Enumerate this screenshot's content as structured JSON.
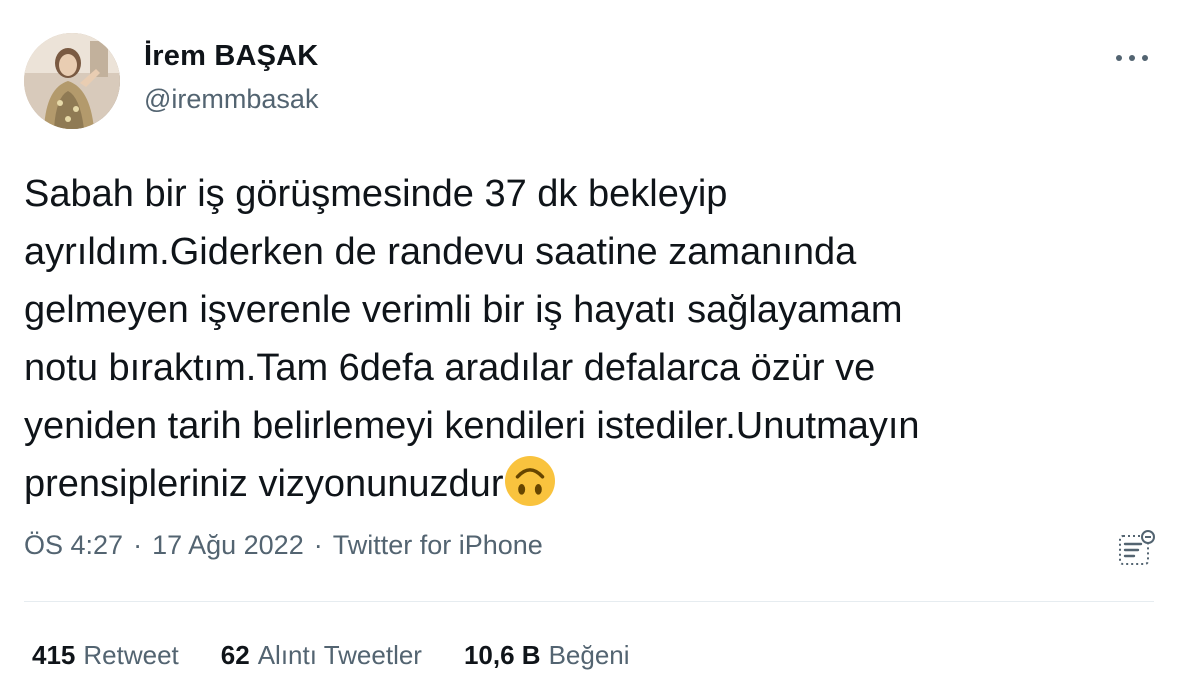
{
  "author": {
    "display_name": "İrem BAŞAK",
    "handle": "@iremmbasak",
    "avatar_icon": "profile-photo"
  },
  "more_icon": "more-horizontal-icon",
  "tweet": {
    "text_lines": [
      "Sabah bir iş görüşmesinde 37 dk bekleyip",
      "ayrıldım.Giderken de randevu saatine zamanında",
      "gelmeyen işverenle verimli bir iş hayatı sağlayamam",
      "notu bıraktım.Tam 6defa aradılar defalarca özür ve",
      "yeniden tarih belirlemeyi kendileri istediler.Unutmayın",
      "prensipleriniz vizyonunuzdur"
    ],
    "emoji": "upside-down-face-emoji"
  },
  "meta": {
    "time": "ÖS 4:27",
    "separator": "·",
    "date": "17 Ağu 2022",
    "source": "Twitter for iPhone"
  },
  "analytics_icon": "analytics-icon",
  "stats": {
    "retweets": {
      "count": "415",
      "label": "Retweet"
    },
    "quotes": {
      "count": "62",
      "label": "Alıntı Tweetler"
    },
    "likes": {
      "count": "10,6 B",
      "label": "Beğeni"
    }
  },
  "colors": {
    "text_primary": "#0f1419",
    "text_secondary": "#536471",
    "divider": "#e6ecf0",
    "emoji_yellow": "#f9c33e"
  }
}
